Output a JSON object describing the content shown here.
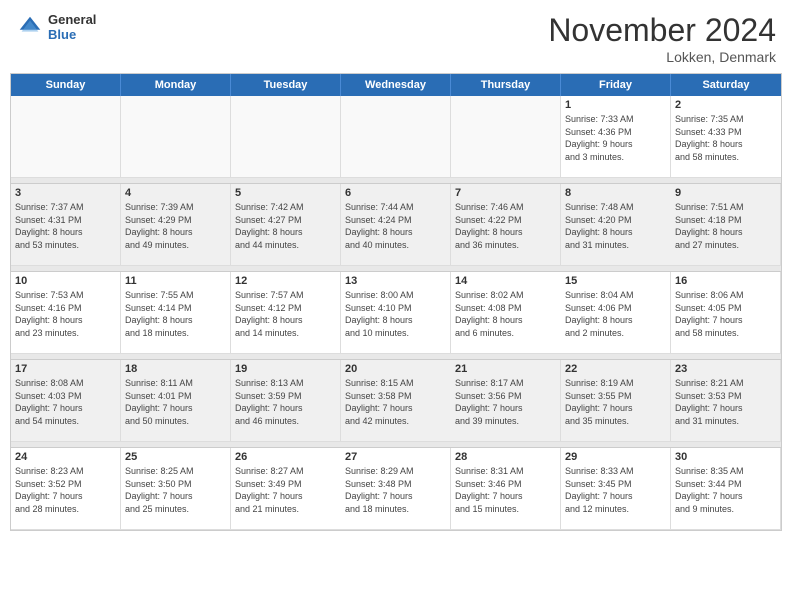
{
  "logo": {
    "general": "General",
    "blue": "Blue"
  },
  "title": "November 2024",
  "location": "Lokken, Denmark",
  "days_header": [
    "Sunday",
    "Monday",
    "Tuesday",
    "Wednesday",
    "Thursday",
    "Friday",
    "Saturday"
  ],
  "weeks": [
    {
      "cells": [
        {
          "day": "",
          "info": "",
          "empty": true
        },
        {
          "day": "",
          "info": "",
          "empty": true
        },
        {
          "day": "",
          "info": "",
          "empty": true
        },
        {
          "day": "",
          "info": "",
          "empty": true
        },
        {
          "day": "",
          "info": "",
          "empty": true
        },
        {
          "day": "1",
          "info": "Sunrise: 7:33 AM\nSunset: 4:36 PM\nDaylight: 9 hours\nand 3 minutes."
        },
        {
          "day": "2",
          "info": "Sunrise: 7:35 AM\nSunset: 4:33 PM\nDaylight: 8 hours\nand 58 minutes."
        }
      ]
    },
    {
      "cells": [
        {
          "day": "3",
          "info": "Sunrise: 7:37 AM\nSunset: 4:31 PM\nDaylight: 8 hours\nand 53 minutes."
        },
        {
          "day": "4",
          "info": "Sunrise: 7:39 AM\nSunset: 4:29 PM\nDaylight: 8 hours\nand 49 minutes."
        },
        {
          "day": "5",
          "info": "Sunrise: 7:42 AM\nSunset: 4:27 PM\nDaylight: 8 hours\nand 44 minutes."
        },
        {
          "day": "6",
          "info": "Sunrise: 7:44 AM\nSunset: 4:24 PM\nDaylight: 8 hours\nand 40 minutes."
        },
        {
          "day": "7",
          "info": "Sunrise: 7:46 AM\nSunset: 4:22 PM\nDaylight: 8 hours\nand 36 minutes."
        },
        {
          "day": "8",
          "info": "Sunrise: 7:48 AM\nSunset: 4:20 PM\nDaylight: 8 hours\nand 31 minutes."
        },
        {
          "day": "9",
          "info": "Sunrise: 7:51 AM\nSunset: 4:18 PM\nDaylight: 8 hours\nand 27 minutes."
        }
      ]
    },
    {
      "cells": [
        {
          "day": "10",
          "info": "Sunrise: 7:53 AM\nSunset: 4:16 PM\nDaylight: 8 hours\nand 23 minutes."
        },
        {
          "day": "11",
          "info": "Sunrise: 7:55 AM\nSunset: 4:14 PM\nDaylight: 8 hours\nand 18 minutes."
        },
        {
          "day": "12",
          "info": "Sunrise: 7:57 AM\nSunset: 4:12 PM\nDaylight: 8 hours\nand 14 minutes."
        },
        {
          "day": "13",
          "info": "Sunrise: 8:00 AM\nSunset: 4:10 PM\nDaylight: 8 hours\nand 10 minutes."
        },
        {
          "day": "14",
          "info": "Sunrise: 8:02 AM\nSunset: 4:08 PM\nDaylight: 8 hours\nand 6 minutes."
        },
        {
          "day": "15",
          "info": "Sunrise: 8:04 AM\nSunset: 4:06 PM\nDaylight: 8 hours\nand 2 minutes."
        },
        {
          "day": "16",
          "info": "Sunrise: 8:06 AM\nSunset: 4:05 PM\nDaylight: 7 hours\nand 58 minutes."
        }
      ]
    },
    {
      "cells": [
        {
          "day": "17",
          "info": "Sunrise: 8:08 AM\nSunset: 4:03 PM\nDaylight: 7 hours\nand 54 minutes."
        },
        {
          "day": "18",
          "info": "Sunrise: 8:11 AM\nSunset: 4:01 PM\nDaylight: 7 hours\nand 50 minutes."
        },
        {
          "day": "19",
          "info": "Sunrise: 8:13 AM\nSunset: 3:59 PM\nDaylight: 7 hours\nand 46 minutes."
        },
        {
          "day": "20",
          "info": "Sunrise: 8:15 AM\nSunset: 3:58 PM\nDaylight: 7 hours\nand 42 minutes."
        },
        {
          "day": "21",
          "info": "Sunrise: 8:17 AM\nSunset: 3:56 PM\nDaylight: 7 hours\nand 39 minutes."
        },
        {
          "day": "22",
          "info": "Sunrise: 8:19 AM\nSunset: 3:55 PM\nDaylight: 7 hours\nand 35 minutes."
        },
        {
          "day": "23",
          "info": "Sunrise: 8:21 AM\nSunset: 3:53 PM\nDaylight: 7 hours\nand 31 minutes."
        }
      ]
    },
    {
      "cells": [
        {
          "day": "24",
          "info": "Sunrise: 8:23 AM\nSunset: 3:52 PM\nDaylight: 7 hours\nand 28 minutes."
        },
        {
          "day": "25",
          "info": "Sunrise: 8:25 AM\nSunset: 3:50 PM\nDaylight: 7 hours\nand 25 minutes."
        },
        {
          "day": "26",
          "info": "Sunrise: 8:27 AM\nSunset: 3:49 PM\nDaylight: 7 hours\nand 21 minutes."
        },
        {
          "day": "27",
          "info": "Sunrise: 8:29 AM\nSunset: 3:48 PM\nDaylight: 7 hours\nand 18 minutes."
        },
        {
          "day": "28",
          "info": "Sunrise: 8:31 AM\nSunset: 3:46 PM\nDaylight: 7 hours\nand 15 minutes."
        },
        {
          "day": "29",
          "info": "Sunrise: 8:33 AM\nSunset: 3:45 PM\nDaylight: 7 hours\nand 12 minutes."
        },
        {
          "day": "30",
          "info": "Sunrise: 8:35 AM\nSunset: 3:44 PM\nDaylight: 7 hours\nand 9 minutes."
        }
      ]
    }
  ]
}
